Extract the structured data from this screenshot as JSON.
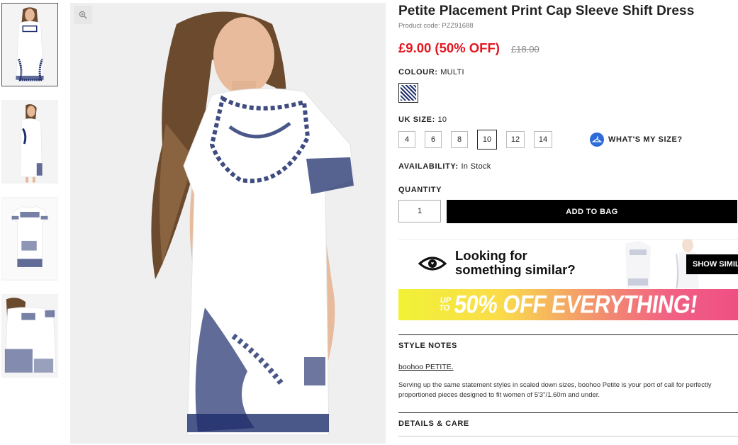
{
  "product": {
    "title": "Petite Placement Print Cap Sleeve Shift Dress",
    "code": "Product code: PZZ91688",
    "price_now": "£9.00 (50% OFF)",
    "price_was": "£18.00"
  },
  "colour": {
    "label": "COLOUR:",
    "value": "MULTI"
  },
  "size": {
    "label": "UK SIZE:",
    "value": "10",
    "options": [
      "4",
      "6",
      "8",
      "10",
      "12",
      "14"
    ],
    "selected": "10",
    "whats_my_size": "WHAT'S MY SIZE?"
  },
  "availability": {
    "label": "AVAILABILITY:",
    "value": "In Stock"
  },
  "quantity": {
    "label": "QUANTITY",
    "value": "1"
  },
  "add_to_bag": "ADD TO BAG",
  "similar": {
    "line1": "Looking for",
    "line2": "something similar?",
    "button": "SHOW SIMIL"
  },
  "promo": {
    "upto_1": "UP",
    "upto_2": "TO",
    "main": "50% OFF EVERYTHING!"
  },
  "style_notes": {
    "heading": "STYLE NOTES",
    "brand": "boohoo PETITE.",
    "description": "Serving up the same statement styles in scaled down sizes, boohoo Petite is your port of call for perfectly proportioned pieces designed to fit women of 5'3\"/1.60m and under."
  },
  "details_heading": "DETAILS & CARE",
  "colors": {
    "price_red": "#e4151f",
    "print_blue": "#1d2d6b",
    "accent_blue": "#2c6bd8"
  }
}
